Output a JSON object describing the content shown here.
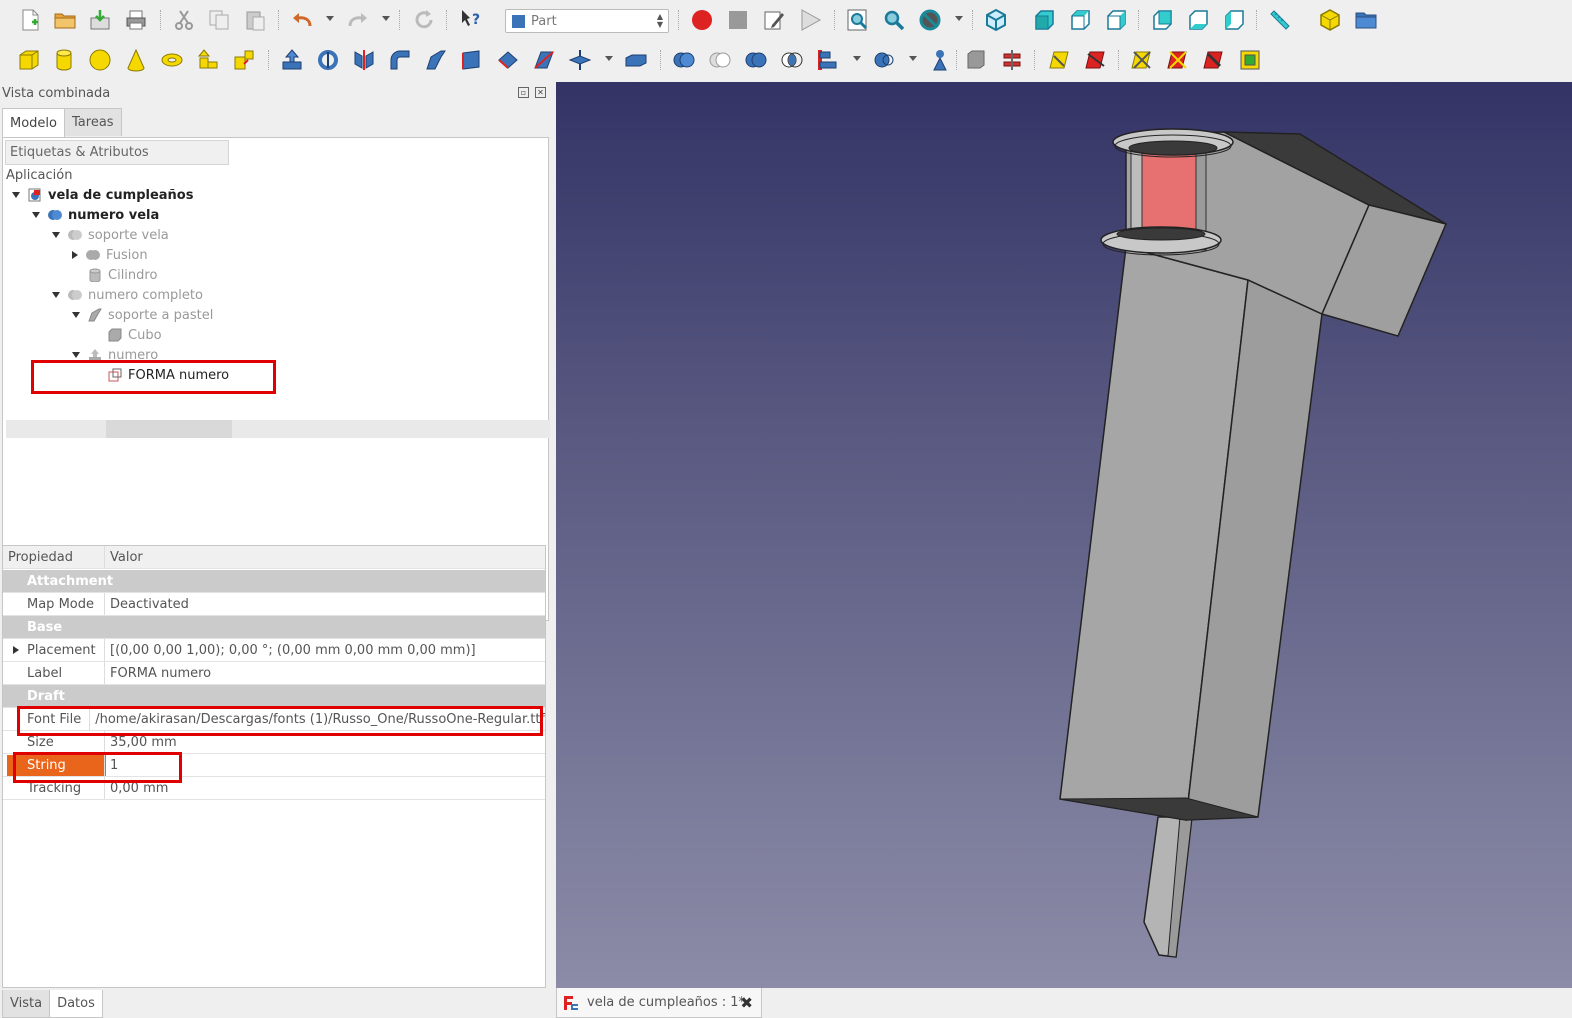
{
  "toolbar": {
    "workbench": "Part"
  },
  "panel": {
    "title": "Vista combinada",
    "tabs": [
      "Modelo",
      "Tareas"
    ],
    "tree_header": "Etiquetas & Atributos",
    "tree": {
      "root": "Aplicación",
      "items": [
        {
          "label": "vela de cumpleaños"
        },
        {
          "label": "numero vela"
        },
        {
          "label": "soporte vela"
        },
        {
          "label": "Fusion"
        },
        {
          "label": "Cilindro"
        },
        {
          "label": "numero completo"
        },
        {
          "label": "soporte a pastel"
        },
        {
          "label": "Cubo"
        },
        {
          "label": "numero"
        },
        {
          "label": "FORMA numero"
        }
      ]
    },
    "properties": {
      "headers": [
        "Propiedad",
        "Valor"
      ],
      "groups": {
        "attachment": "Attachment",
        "base": "Base",
        "draft": "Draft"
      },
      "rows": {
        "map_mode": {
          "name": "Map Mode",
          "value": "Deactivated"
        },
        "placement": {
          "name": "Placement",
          "value": "[(0,00 0,00 1,00); 0,00 °; (0,00 mm  0,00 mm  0,00 mm)]"
        },
        "label": {
          "name": "Label",
          "value": "FORMA numero"
        },
        "font_file": {
          "name": "Font File",
          "value": "/home/akirasan/Descargas/fonts (1)/Russo_One/RussoOne-Regular.ttf"
        },
        "size": {
          "name": "Size",
          "value": "35,00 mm"
        },
        "string": {
          "name": "String",
          "value": "1"
        },
        "tracking": {
          "name": "Tracking",
          "value": "0,00 mm"
        }
      }
    },
    "bottom_tabs": [
      "Vista",
      "Datos"
    ]
  },
  "document_tab": {
    "label": "vela de cumpleaños : 1*"
  },
  "colors": {
    "highlight_red": "#e00000",
    "selected_orange": "#e8651b",
    "view_top": "#333366",
    "view_bottom": "#8c8ca8"
  }
}
